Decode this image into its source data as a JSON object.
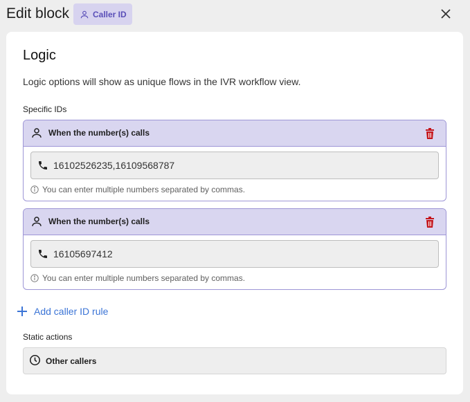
{
  "header": {
    "title": "Edit block",
    "badge_label": "Caller ID",
    "close_icon": "close-icon"
  },
  "logic": {
    "title": "Logic",
    "description": "Logic options will show as unique flows in the IVR workflow view."
  },
  "specific_ids": {
    "label": "Specific IDs",
    "rules": [
      {
        "title": "When the number(s) calls",
        "value": "16102526235,16109568787",
        "hint": "You can enter multiple numbers separated by commas."
      },
      {
        "title": "When the number(s) calls",
        "value": "16105697412",
        "hint": "You can enter multiple numbers separated by commas."
      }
    ]
  },
  "add_rule_label": "Add caller ID rule",
  "static_actions": {
    "label": "Static actions",
    "item_label": "Other callers"
  },
  "colors": {
    "accent_purple": "#5a4fb8",
    "rule_header": "#d9d6f0",
    "trash_red": "#c4161c",
    "link_blue": "#3b74d6"
  }
}
